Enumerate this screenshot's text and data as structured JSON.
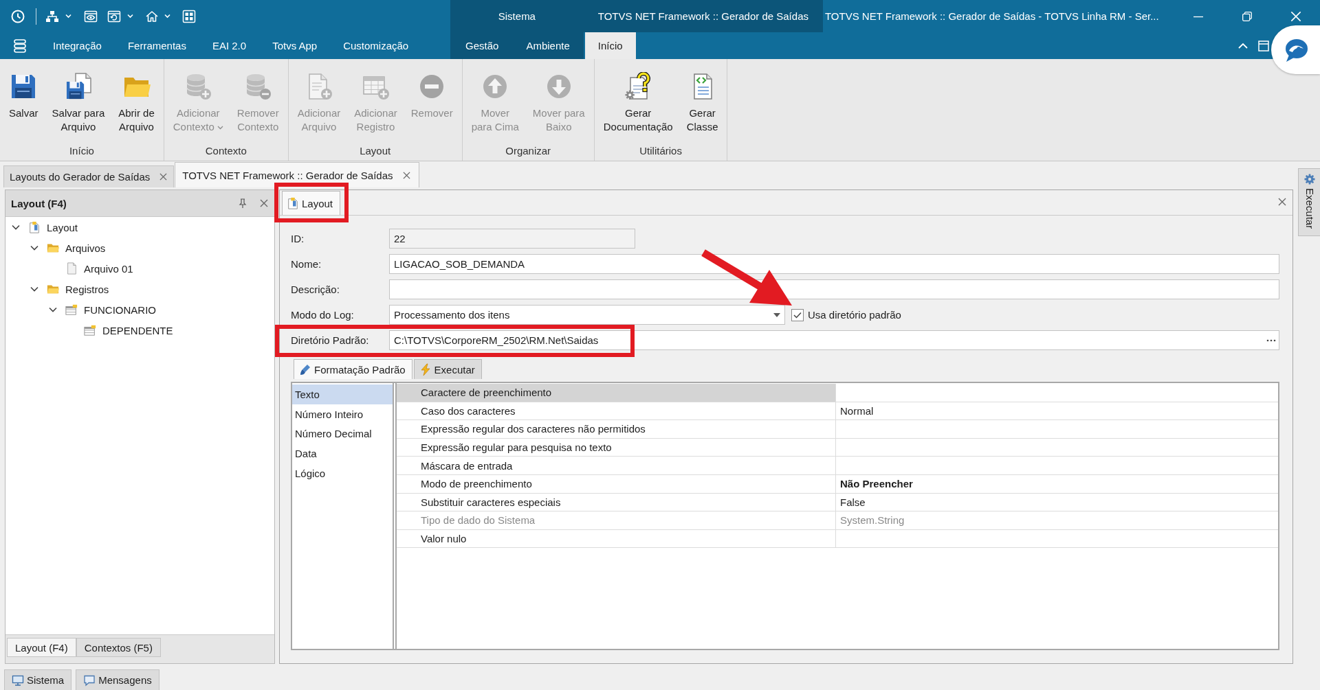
{
  "window": {
    "title": "TOTVS NET Framework :: Gerador de Saídas - TOTVS Linha RM - Ser..."
  },
  "ribbon": {
    "tabs": [
      {
        "label": "Integração",
        "selected": false
      },
      {
        "label": "Ferramentas",
        "selected": false
      },
      {
        "label": "EAI 2.0",
        "selected": false
      },
      {
        "label": "Totvs App",
        "selected": false
      },
      {
        "label": "Customização",
        "selected": false
      }
    ],
    "contexts": [
      {
        "label": "Sistema",
        "tabs": [
          {
            "label": "Gestão",
            "selected": false
          },
          {
            "label": "Ambiente",
            "selected": false
          }
        ]
      },
      {
        "label": "TOTVS NET Framework :: Gerador de Saídas",
        "tabs": [
          {
            "label": "Início",
            "selected": true
          }
        ]
      }
    ],
    "groups": [
      {
        "label": "Início",
        "buttons": [
          {
            "label": "Salvar",
            "disabled": false,
            "has_menu": false
          },
          {
            "label": "Salvar para\nArquivo",
            "disabled": false,
            "has_menu": false
          },
          {
            "label": "Abrir de\nArquivo",
            "disabled": false,
            "has_menu": false
          }
        ]
      },
      {
        "label": "Contexto",
        "buttons": [
          {
            "label": "Adicionar\nContexto",
            "disabled": true,
            "has_menu": true
          },
          {
            "label": "Remover\nContexto",
            "disabled": true,
            "has_menu": false
          }
        ]
      },
      {
        "label": "Layout",
        "buttons": [
          {
            "label": "Adicionar\nArquivo",
            "disabled": true,
            "has_menu": false
          },
          {
            "label": "Adicionar\nRegistro",
            "disabled": true,
            "has_menu": false
          },
          {
            "label": "Remover",
            "disabled": true,
            "has_menu": false
          }
        ]
      },
      {
        "label": "Organizar",
        "buttons": [
          {
            "label": "Mover\npara Cima",
            "disabled": true,
            "has_menu": false
          },
          {
            "label": "Mover para\nBaixo",
            "disabled": true,
            "has_menu": false
          }
        ]
      },
      {
        "label": "Utilitários",
        "buttons": [
          {
            "label": "Gerar\nDocumentação",
            "disabled": false,
            "has_menu": false
          },
          {
            "label": "Gerar\nClasse",
            "disabled": false,
            "has_menu": false
          }
        ]
      }
    ]
  },
  "document_tabs": [
    {
      "label": "Layouts do Gerador de Saídas",
      "selected": false
    },
    {
      "label": "TOTVS NET Framework :: Gerador de Saídas",
      "selected": true
    }
  ],
  "tree_panel": {
    "title": "Layout (F4)",
    "items": [
      {
        "kind": "layout",
        "label": "Layout",
        "expanded": true,
        "children": [
          {
            "kind": "folder",
            "label": "Arquivos",
            "expanded": true,
            "children": [
              {
                "kind": "file",
                "label": "Arquivo 01"
              }
            ]
          },
          {
            "kind": "folder",
            "label": "Registros",
            "expanded": true,
            "children": [
              {
                "kind": "record",
                "label": "FUNCIONARIO",
                "expanded": true,
                "children": [
                  {
                    "kind": "record",
                    "label": "DEPENDENTE"
                  }
                ]
              }
            ]
          }
        ]
      }
    ],
    "tabs": [
      {
        "label": "Layout (F4)",
        "selected": true
      },
      {
        "label": "Contextos (F5)",
        "selected": false
      }
    ]
  },
  "detail": {
    "tab": {
      "label": "Layout",
      "selected": true,
      "highlighted": true
    },
    "fields": [
      {
        "kind": "number",
        "label": "ID:",
        "value": "22",
        "readonly": true,
        "highlighted": false
      },
      {
        "kind": "text",
        "label": "Nome:",
        "value": "LIGACAO_SOB_DEMANDA",
        "readonly": false,
        "highlighted": false
      },
      {
        "kind": "text",
        "label": "Descrição:",
        "readonly": false,
        "highlighted": false
      },
      {
        "kind": "dropdown",
        "label": "Modo do Log:",
        "value": "Processamento dos itens",
        "readonly": false,
        "highlighted": false,
        "checkbox": {
          "label": "Usa diretório padrão",
          "checked": true,
          "pointed_at": true
        }
      },
      {
        "kind": "path",
        "label": "Diretório Padrão:",
        "value": "C:\\TOTVS\\CorporeRM_2502\\RM.Net\\Saidas",
        "readonly": false,
        "highlighted": true
      }
    ],
    "subtabs": [
      {
        "label": "Formatação Padrão",
        "selected": true
      },
      {
        "label": "Executar",
        "selected": false
      }
    ],
    "types": [
      {
        "label": "Texto",
        "selected": true
      },
      {
        "label": "Número Inteiro",
        "selected": false
      },
      {
        "label": "Número Decimal",
        "selected": false
      },
      {
        "label": "Data",
        "selected": false
      },
      {
        "label": "Lógico",
        "selected": false
      }
    ],
    "properties": [
      {
        "name": "Caractere de preenchimento",
        "selected": true,
        "disabled": false
      },
      {
        "name": "Caso dos caracteres",
        "value": "Normal",
        "selected": false,
        "disabled": false,
        "modified": false
      },
      {
        "name": "Expressão regular dos caracteres não permitidos",
        "selected": false,
        "disabled": false
      },
      {
        "name": "Expressão regular para pesquisa no texto",
        "selected": false,
        "disabled": false
      },
      {
        "name": "Máscara de entrada",
        "selected": false,
        "disabled": false
      },
      {
        "name": "Modo de preenchimento",
        "value": "Não Preencher",
        "selected": false,
        "disabled": false,
        "modified": true
      },
      {
        "name": "Substituir caracteres especiais",
        "value": "False",
        "selected": false,
        "disabled": false,
        "modified": false
      },
      {
        "name": "Tipo de dado do Sistema",
        "value": "System.String",
        "selected": false,
        "disabled": true,
        "modified": false
      },
      {
        "name": "Valor nulo",
        "selected": false,
        "disabled": false
      }
    ]
  },
  "side_tab": {
    "label": "Executar"
  },
  "status_bar": {
    "tabs": [
      {
        "label": "Sistema"
      },
      {
        "label": "Mensagens"
      }
    ]
  }
}
